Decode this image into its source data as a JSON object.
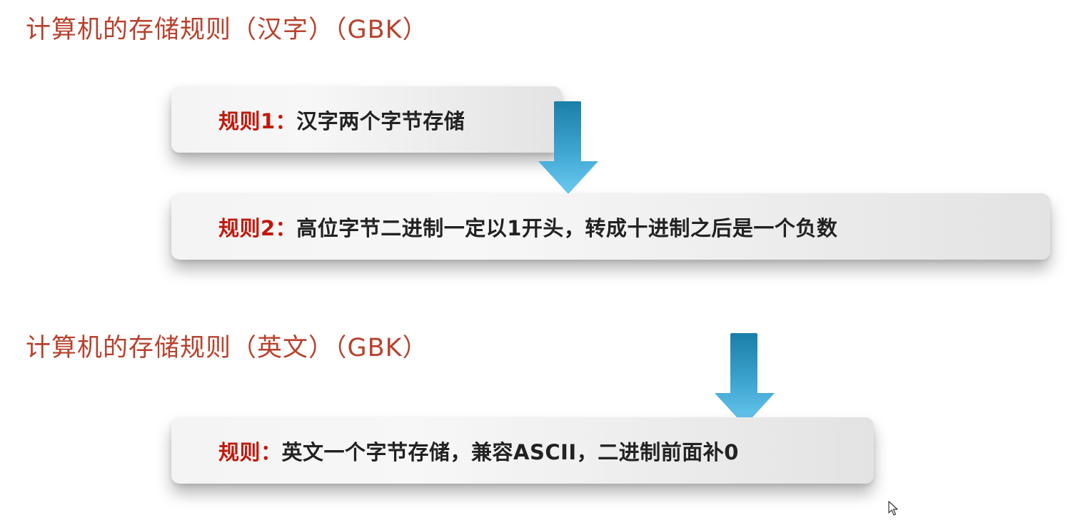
{
  "sections": [
    {
      "title": "计算机的存储规则（汉字）（GBK）",
      "rules": [
        {
          "label": "规则1：",
          "text": "汉字两个字节存储"
        },
        {
          "label": "规则2：",
          "text": "高位字节二进制一定以1开头，转成十进制之后是一个负数"
        }
      ]
    },
    {
      "title": "计算机的存储规则（英文）（GBK）",
      "rules": [
        {
          "label": "规则：",
          "text": "英文一个字节存储，兼容ASCII，二进制前面补0"
        }
      ]
    }
  ],
  "colors": {
    "title": "#b8412d",
    "rule_label": "#c0190c",
    "rule_text": "#222222",
    "arrow_top": "#1a7fa8",
    "arrow_bottom": "#6ccaf0"
  },
  "icons": {
    "arrow": "arrow-down-icon",
    "cursor": "mouse-pointer-icon"
  }
}
